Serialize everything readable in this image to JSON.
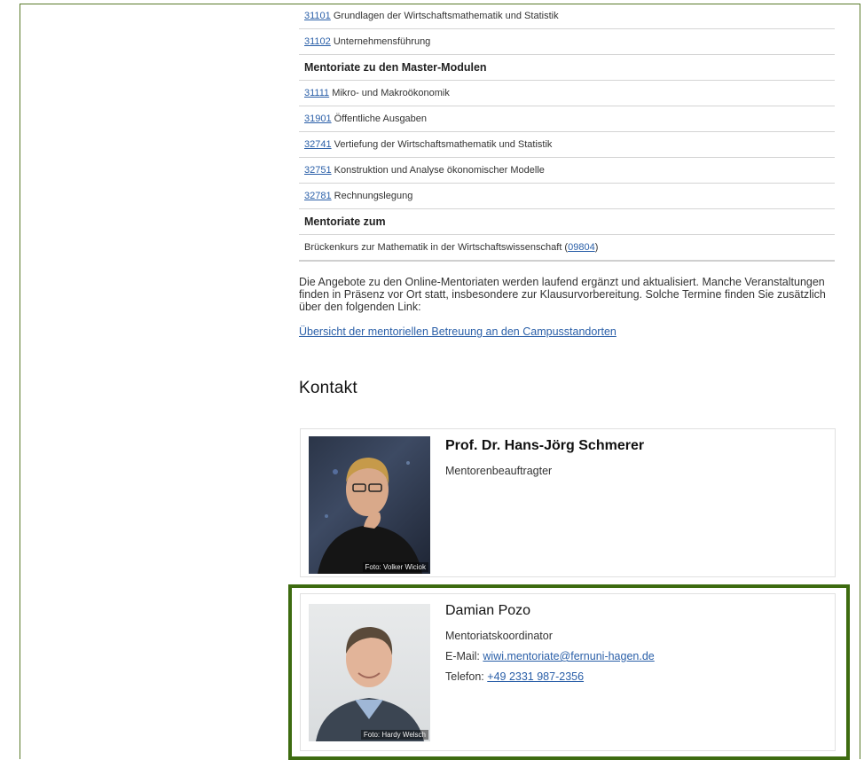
{
  "modules": [
    {
      "code": "31101",
      "title": "Grundlagen der Wirtschaftsmathematik und Statistik"
    },
    {
      "code": "31102",
      "title": "Unternehmensführung"
    }
  ],
  "master_heading": "Mentoriate zu den Master-Modulen",
  "master_modules": [
    {
      "code": "31111",
      "title": "Mikro- und Makroökonomik"
    },
    {
      "code": "31901",
      "title": "Öffentliche Ausgaben"
    },
    {
      "code": "32741",
      "title": "Vertiefung der Wirtschaftsmathematik und Statistik"
    },
    {
      "code": "32751",
      "title": "Konstruktion und Analyse ökonomischer Modelle"
    },
    {
      "code": "32781",
      "title": "Rechnungslegung"
    }
  ],
  "zum_heading": "Mentoriate zum",
  "bridge": {
    "prefix": "Brückenkurs zur Mathematik in der Wirtschaftswissenschaft (",
    "code": "09804",
    "suffix": ")"
  },
  "paragraph": "Die Angebote zu den Online-Mentoriaten werden laufend ergänzt und aktualisiert. Manche Veranstaltungen finden in Präsenz vor Ort statt, insbesondere zur Klausurvorbereitung. Solche Termine finden Sie zusätzlich über den folgenden Link:",
  "overview_link": "Übersicht der mentoriellen Betreuung an den Campusstandorten",
  "contact_heading": "Kontakt",
  "contacts": [
    {
      "name": "Prof. Dr. Hans-Jörg Schmerer",
      "role": "Mentorenbeauftragter",
      "photo_credit": "Foto: Volker Wiciok"
    },
    {
      "name": "Damian Pozo",
      "role": "Mentoriatskoordinator",
      "email_label": "E-Mail:",
      "email": "wiwi.mentoriate@fernuni-hagen.de",
      "phone_label": "Telefon:",
      "phone": "+49 2331 987-2356",
      "photo_credit": "Foto: Hardy Welsch"
    }
  ]
}
